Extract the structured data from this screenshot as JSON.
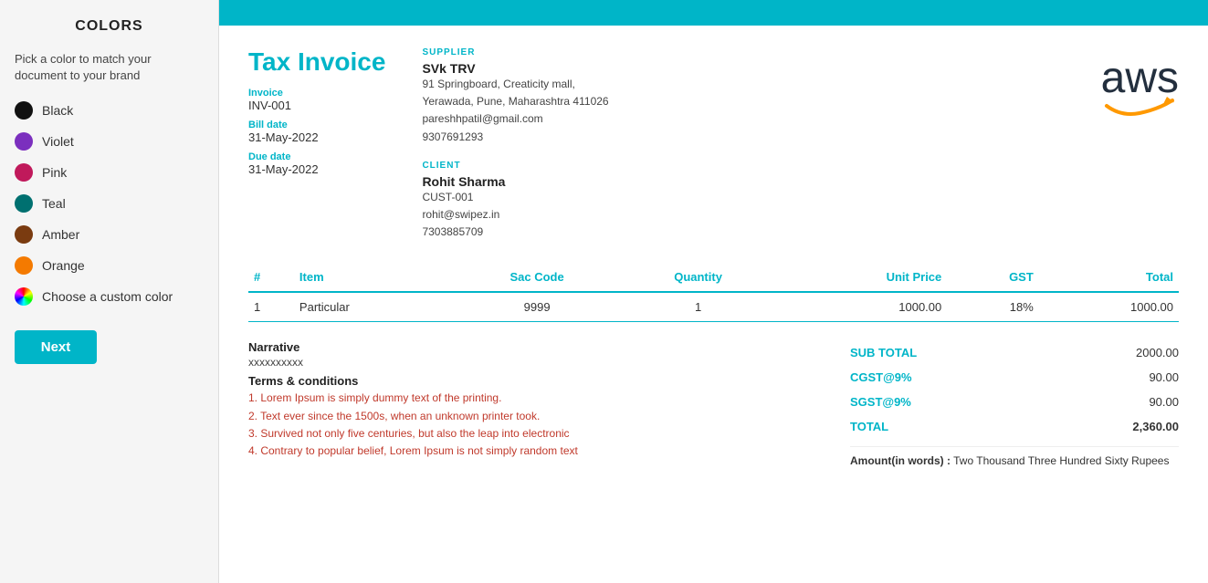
{
  "leftPanel": {
    "title": "COLORS",
    "subtitle": "Pick a color to match your document to your brand",
    "colors": [
      {
        "name": "Black",
        "hex": "#111111"
      },
      {
        "name": "Violet",
        "hex": "#7b2fbe"
      },
      {
        "name": "Pink",
        "hex": "#c0195b"
      },
      {
        "name": "Teal",
        "hex": "#007070"
      },
      {
        "name": "Amber",
        "hex": "#7a3b10"
      },
      {
        "name": "Orange",
        "hex": "#f47a00"
      }
    ],
    "customColor": "Choose a custom color",
    "nextButton": "Next"
  },
  "invoice": {
    "title": "Tax Invoice",
    "fields": [
      {
        "label": "Invoice",
        "value": "INV-001"
      },
      {
        "label": "Bill date",
        "value": "31-May-2022"
      },
      {
        "label": "Due date",
        "value": "31-May-2022"
      }
    ],
    "supplier": {
      "sectionLabel": "SUPPLIER",
      "name": "SVk TRV",
      "address": "91 Springboard, Creaticity mall,",
      "city": "Yerawada, Pune, Maharashtra 411026",
      "email": "pareshhpatil@gmail.com",
      "phone": "9307691293"
    },
    "client": {
      "sectionLabel": "CLIENT",
      "name": "Rohit Sharma",
      "id": "CUST-001",
      "email": "rohit@swipez.in",
      "phone": "7303885709"
    },
    "tableHeaders": [
      "#",
      "Item",
      "Sac Code",
      "Quantity",
      "Unit Price",
      "GST",
      "Total"
    ],
    "tableRows": [
      {
        "num": "1",
        "item": "Particular",
        "sacCode": "9999",
        "quantity": "1",
        "unitPrice": "1000.00",
        "gst": "18%",
        "total": "1000.00"
      }
    ],
    "narrative": {
      "title": "Narrative",
      "text": "xxxxxxxxxx"
    },
    "terms": {
      "title": "Terms & conditions",
      "lines": [
        "1. Lorem Ipsum is simply dummy text of the printing.",
        "2. Text ever since the 1500s, when an unknown printer took.",
        "3. Survived not only five centuries, but also the leap into electronic",
        "4. Contrary to popular belief, Lorem Ipsum is not simply random text"
      ]
    },
    "totals": [
      {
        "label": "SUB TOTAL",
        "amount": "2000.00"
      },
      {
        "label": "CGST@9%",
        "amount": "90.00"
      },
      {
        "label": "SGST@9%",
        "amount": "90.00"
      },
      {
        "label": "TOTAL",
        "amount": "2,360.00"
      }
    ],
    "amountWords": {
      "prefix": "Amount(in words) :",
      "text": "Two Thousand Three Hundred Sixty Rupees"
    }
  }
}
